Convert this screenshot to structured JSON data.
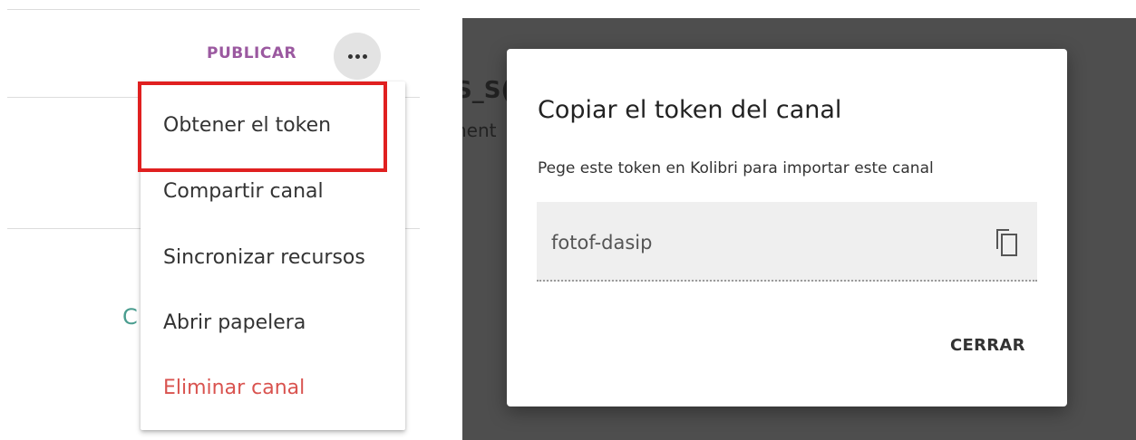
{
  "header": {
    "publish_label": "PUBLICAR"
  },
  "more_menu": {
    "items": [
      {
        "label": "Obtener el token",
        "danger": false
      },
      {
        "label": "Compartir canal",
        "danger": false
      },
      {
        "label": "Sincronizar recursos",
        "danger": false
      },
      {
        "label": "Abrir papelera",
        "danger": false
      },
      {
        "label": "Eliminar canal",
        "danger": true
      }
    ],
    "highlighted_item": "Obtener el token"
  },
  "background": {
    "partial_title": "S_S(",
    "partial_sub": "nent",
    "green_glyph": "C"
  },
  "dialog": {
    "title": "Copiar el token del canal",
    "description": "Pege este token en Kolibri para importar este canal",
    "token": "fotof-dasip",
    "copy_icon": "copy-icon",
    "close_label": "CERRAR"
  },
  "colors": {
    "publish": "#9b59a0",
    "danger": "#d9534f",
    "highlight": "#e02020",
    "overlay": "#4e4e4e"
  }
}
